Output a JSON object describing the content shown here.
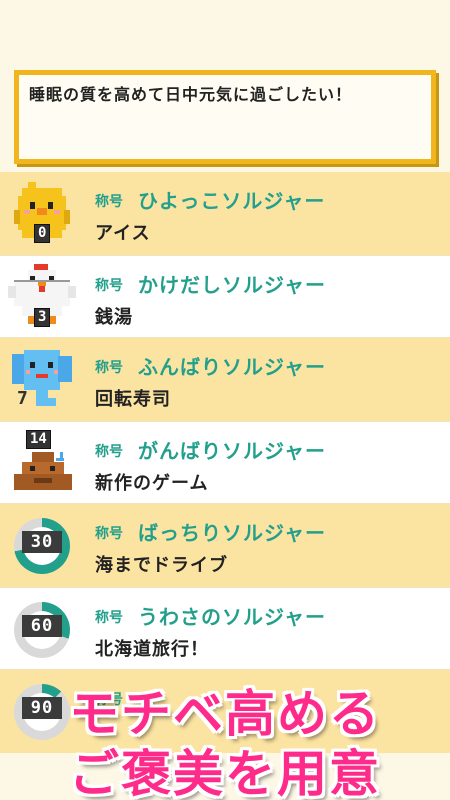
{
  "goal": {
    "text": "睡眠の質を高めて日中元気に過ごしたい！"
  },
  "rows": [
    {
      "label": "称号",
      "title": "ひよっこソルジャー",
      "reward": "アイス",
      "level": "0",
      "icon": "chick-icon"
    },
    {
      "label": "称号",
      "title": "かけだしソルジャー",
      "reward": "銭湯",
      "level": "3",
      "icon": "chicken-icon"
    },
    {
      "label": "称号",
      "title": "ふんばりソルジャー",
      "reward": "回転寿司",
      "level": "7",
      "icon": "elephant-icon"
    },
    {
      "label": "称号",
      "title": "がんばりソルジャー",
      "reward": "新作のゲーム",
      "level": "14",
      "icon": "poop-icon"
    },
    {
      "label": "称号",
      "title": "ばっちりソルジャー",
      "reward": "海までドライブ",
      "level": "30",
      "icon": "progress-ring-icon",
      "progress": 0.72
    },
    {
      "label": "称号",
      "title": "うわさのソルジャー",
      "reward": "北海道旅行！",
      "level": "60",
      "icon": "progress-ring-icon",
      "progress": 0.3
    },
    {
      "label": "称号",
      "title": "",
      "reward": "",
      "level": "90",
      "icon": "progress-ring-icon",
      "progress": 0.12
    }
  ],
  "banner": {
    "line1": "モチベ高める",
    "line2": "ご褒美を用意"
  },
  "colors": {
    "accent": "#23a08c",
    "row_alt": "#fbe3a2",
    "banner": "#ff2b8a",
    "frame": "#f1b61e"
  }
}
